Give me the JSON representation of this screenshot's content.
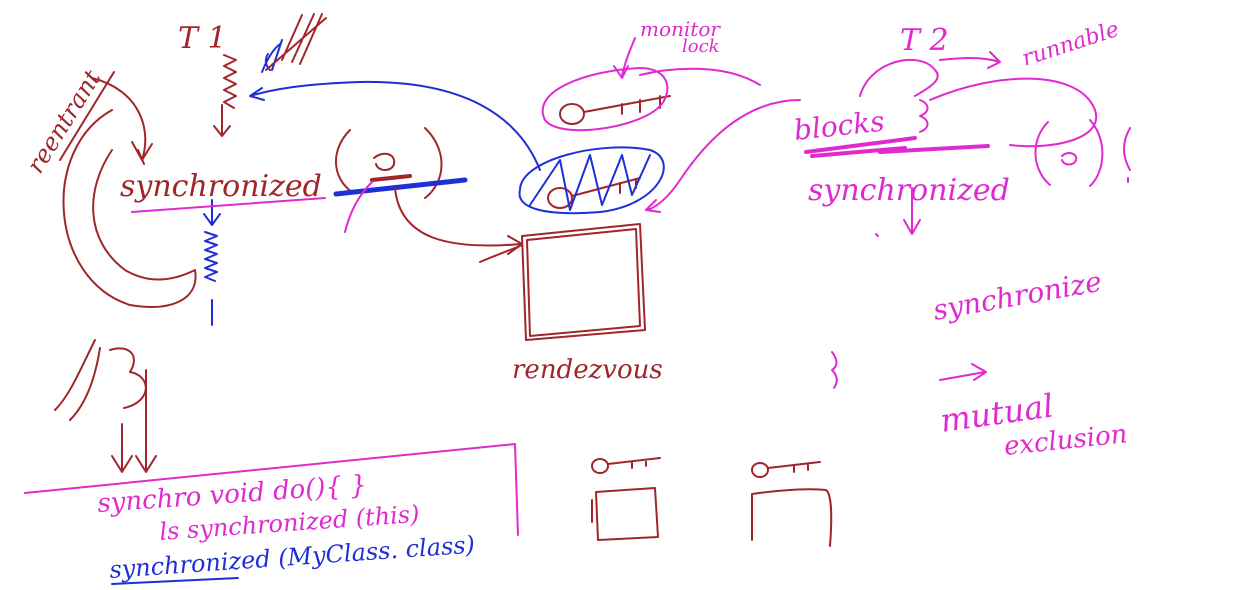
{
  "colors": {
    "brown": "#a0262a",
    "blue": "#1f2fd6",
    "magenta": "#e02ad0",
    "background": "#ffffff"
  },
  "labels": {
    "t1": "T 1",
    "t2": "T 2",
    "reentrant": "reentrant",
    "synchronized_left": "synchronized",
    "synchronized_right": "synchronized",
    "monitor_lock": [
      "monitor",
      "lock"
    ],
    "runnable": "runnable",
    "blocks": "blocks",
    "rendezvous": "rendezvous",
    "synchronize": "synchronize",
    "mutual_exclusion": [
      "mutual",
      "exclusion"
    ],
    "synch_void": "synchro void do(){ }",
    "ls_synchronized": "ls synchronized (this)",
    "synchronized_class": "synchronized (MyClass. class)"
  }
}
